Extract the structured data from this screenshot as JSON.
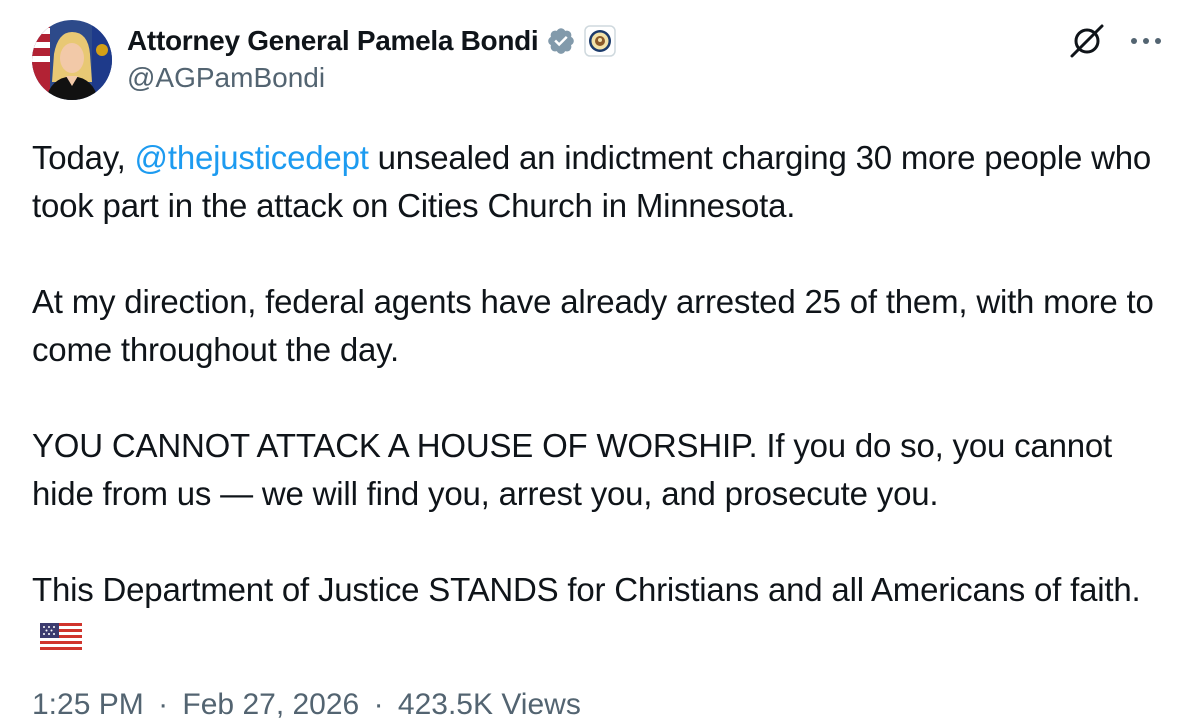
{
  "author": {
    "display_name": "Attorney General Pamela Bondi",
    "handle": "@AGPamBondi",
    "verified_badge_icon": "verified-check-icon",
    "affiliation_icon": "doj-seal-icon",
    "badge_color": "#829aab"
  },
  "actions": {
    "grok_icon": "grok-icon",
    "more_icon": "more-icon"
  },
  "tweet": {
    "p1_before": "Today, ",
    "p1_mention": "@thejusticedept",
    "p1_after": " unsealed an indictment charging 30 more people who took part in the attack on Cities Church in Minnesota.",
    "p2": "At my direction, federal agents have already arrested 25 of them, with more to come throughout the day.",
    "p3": "YOU CANNOT ATTACK A HOUSE OF WORSHIP. If you do so, you cannot hide from us — we will find you, arrest you, and prosecute you.",
    "p4": "This Department of Justice STANDS for Christians and all Americans of faith.",
    "flag_icon": "us-flag-icon"
  },
  "meta": {
    "time": "1:25 PM",
    "sep1": "·",
    "date": "Feb 27, 2026",
    "sep2": "·",
    "views": "423.5K Views"
  },
  "colors": {
    "text": "#0f1419",
    "secondary": "#536471",
    "link": "#1d9bf0"
  }
}
